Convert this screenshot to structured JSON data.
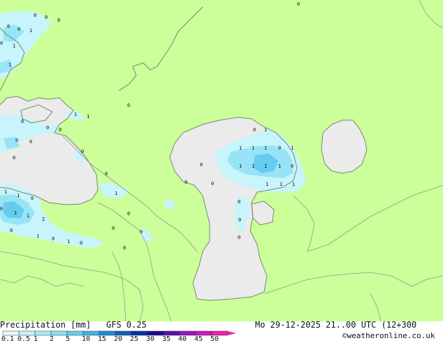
{
  "colors": {
    "land": "#ccff99",
    "sea": "#ebebeb",
    "coast": "#6f8a6f",
    "border": "#8a9a8a",
    "precip_light": "#c8f4fb",
    "precip_mid": "#96e4f6",
    "precip_strong": "#64cdef"
  },
  "footer": {
    "product": "Precipitation [mm]",
    "model": "GFS 0.25",
    "datetime": "Mo 29-12-2025 21..00 UTC (12+300",
    "credit": "©weatheronline.co.uk"
  },
  "legend": {
    "labels": [
      "0.1",
      "0.5",
      "1",
      "2",
      "5",
      "10",
      "15",
      "20",
      "25",
      "30",
      "35",
      "40",
      "45",
      "50"
    ],
    "colors": [
      "#e6fbfd",
      "#c8f4fb",
      "#a8ecf8",
      "#86e0f5",
      "#64cdef",
      "#3fb3e6",
      "#1a8dd8",
      "#0f5fc2",
      "#0a2da8",
      "#1a0c96",
      "#5e0cb4",
      "#9a10c8",
      "#d014c8",
      "#ee20b0"
    ]
  },
  "map_values": [
    {
      "id": "v1",
      "text": "0"
    },
    {
      "id": "v2",
      "text": "0"
    },
    {
      "id": "v3",
      "text": "0"
    },
    {
      "id": "v4",
      "text": "0"
    },
    {
      "id": "v5",
      "text": "0"
    },
    {
      "id": "v6",
      "text": "1"
    },
    {
      "id": "v7",
      "text": "0"
    },
    {
      "id": "v8",
      "text": "1"
    },
    {
      "id": "v9",
      "text": "1"
    },
    {
      "id": "v10",
      "text": "0"
    },
    {
      "id": "v11",
      "text": "0"
    },
    {
      "id": "v12",
      "text": "1"
    },
    {
      "id": "v13",
      "text": "1"
    },
    {
      "id": "v14",
      "text": "0"
    },
    {
      "id": "v15",
      "text": "0"
    },
    {
      "id": "v16",
      "text": "0"
    },
    {
      "id": "v17",
      "text": "0"
    },
    {
      "id": "v18",
      "text": "0"
    },
    {
      "id": "v19",
      "text": "0"
    },
    {
      "id": "v20",
      "text": "0"
    },
    {
      "id": "v21",
      "text": "0"
    },
    {
      "id": "v22",
      "text": "0"
    },
    {
      "id": "v23",
      "text": "0"
    },
    {
      "id": "v24",
      "text": "1"
    },
    {
      "id": "v25",
      "text": "1"
    },
    {
      "id": "v26",
      "text": "0"
    },
    {
      "id": "v27",
      "text": "0"
    },
    {
      "id": "v28",
      "text": "1"
    },
    {
      "id": "v29",
      "text": "1"
    },
    {
      "id": "v30",
      "text": "2"
    },
    {
      "id": "v31",
      "text": "1"
    },
    {
      "id": "v32",
      "text": "0"
    },
    {
      "id": "v33",
      "text": "0"
    },
    {
      "id": "v34",
      "text": "1"
    },
    {
      "id": "v35",
      "text": "0"
    },
    {
      "id": "v36",
      "text": "1"
    },
    {
      "id": "v37",
      "text": "0"
    },
    {
      "id": "v38",
      "text": "0"
    },
    {
      "id": "v39",
      "text": "0"
    },
    {
      "id": "v40",
      "text": "0"
    },
    {
      "id": "v41",
      "text": "0"
    },
    {
      "id": "v42",
      "text": "1"
    },
    {
      "id": "v43",
      "text": "1"
    },
    {
      "id": "v44",
      "text": "1"
    },
    {
      "id": "v45",
      "text": "1"
    },
    {
      "id": "v46",
      "text": "0"
    },
    {
      "id": "v47",
      "text": "1"
    },
    {
      "id": "v48",
      "text": "1"
    },
    {
      "id": "v49",
      "text": "1"
    },
    {
      "id": "v50",
      "text": "1"
    },
    {
      "id": "v51",
      "text": "1"
    },
    {
      "id": "v52",
      "text": "0"
    },
    {
      "id": "v53",
      "text": "0"
    },
    {
      "id": "v54",
      "text": "1"
    },
    {
      "id": "v55",
      "text": "1"
    },
    {
      "id": "v56",
      "text": "1"
    },
    {
      "id": "v57",
      "text": "0"
    },
    {
      "id": "v58",
      "text": "0"
    },
    {
      "id": "v59",
      "text": "0"
    }
  ]
}
